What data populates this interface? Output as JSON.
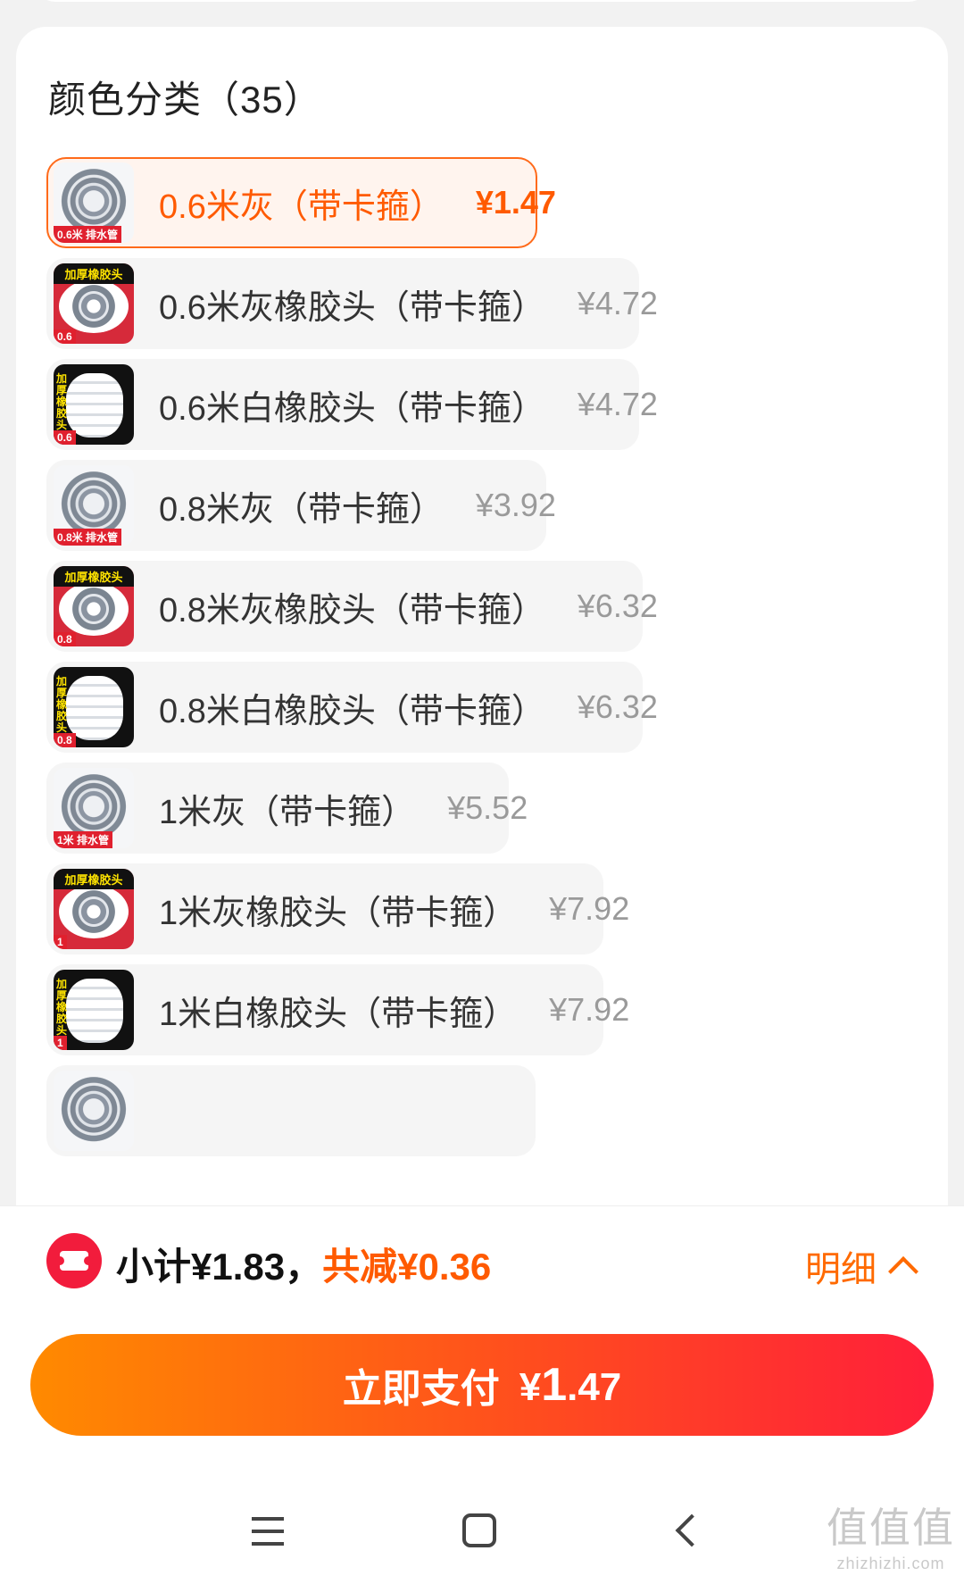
{
  "section": {
    "title": "颜色分类（35）"
  },
  "options": [
    {
      "name": "0.6米灰（带卡箍）",
      "price": "¥1.47",
      "thumb": "gray-hose",
      "tag": "0.6米 排水管",
      "selected": true
    },
    {
      "name": "0.6米灰橡胶头（带卡箍）",
      "price": "¥4.72",
      "thumb": "rubber-gray",
      "tag": "0.6",
      "banner": "加厚橡胶头"
    },
    {
      "name": "0.6米白橡胶头（带卡箍）",
      "price": "¥4.72",
      "thumb": "rubber-white",
      "tag": "0.6",
      "side": "加厚橡胶头"
    },
    {
      "name": "0.8米灰（带卡箍）",
      "price": "¥3.92",
      "thumb": "gray-hose",
      "tag": "0.8米 排水管"
    },
    {
      "name": "0.8米灰橡胶头（带卡箍）",
      "price": "¥6.32",
      "thumb": "rubber-gray",
      "tag": "0.8",
      "banner": "加厚橡胶头"
    },
    {
      "name": "0.8米白橡胶头（带卡箍）",
      "price": "¥6.32",
      "thumb": "rubber-white",
      "tag": "0.8",
      "side": "加厚橡胶头"
    },
    {
      "name": "1米灰（带卡箍）",
      "price": "¥5.52",
      "thumb": "gray-hose",
      "tag": "1米 排水管"
    },
    {
      "name": "1米灰橡胶头（带卡箍）",
      "price": "¥7.92",
      "thumb": "rubber-gray",
      "tag": "1",
      "banner": "加厚橡胶头"
    },
    {
      "name": "1米白橡胶头（带卡箍）",
      "price": "¥7.92",
      "thumb": "rubber-white",
      "tag": "1",
      "side": "加厚橡胶头"
    }
  ],
  "footer": {
    "subtotal_label": "小计¥1.83，",
    "discount_label": "共减¥0.36",
    "detail_label": "明细",
    "pay_label": "立即支付",
    "pay_currency": "¥",
    "pay_int": "1",
    "pay_dec": ".47"
  },
  "watermark": {
    "main": "值值值",
    "sub": "zhizhizhi.com"
  },
  "colors": {
    "accent": "#ff5a00",
    "coupon": "#f21c3c",
    "pay_start": "#ff8a00",
    "pay_end": "#ff1f3a"
  }
}
